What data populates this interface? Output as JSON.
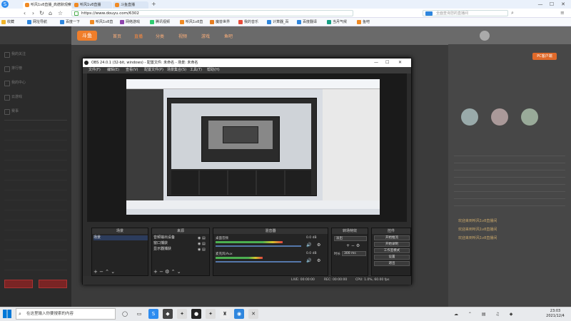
{
  "browser": {
    "tabs": [
      {
        "label": "听风1v8直播_高德默观察"
      },
      {
        "label": "听风1v8直播"
      },
      {
        "label": "斗鱼直播"
      }
    ],
    "address": "https://www.douyu.com/6302",
    "search_placeholder": "全面查询您的直播间",
    "bookmarks": [
      {
        "label": "收藏",
        "color": "#f0b429"
      },
      {
        "label": "网址导航",
        "color": "#2e86de"
      },
      {
        "label": "百度一下",
        "color": "#2e86de"
      },
      {
        "label": "听风1v8直",
        "color": "#f08a24"
      },
      {
        "label": "网络游戏",
        "color": "#8e44ad"
      },
      {
        "label": "腾讯视频",
        "color": "#2ecc71"
      },
      {
        "label": "听风1v8直",
        "color": "#f08a24"
      },
      {
        "label": "魔兽世界",
        "color": "#e67e22"
      },
      {
        "label": "我的音乐",
        "color": "#e74c3c"
      },
      {
        "label": "计算器_百",
        "color": "#2e86de"
      },
      {
        "label": "百度翻译",
        "color": "#2e86de"
      },
      {
        "label": "当月气候",
        "color": "#16a085"
      },
      {
        "label": "鱼吧",
        "color": "#f08a24"
      }
    ]
  },
  "site": {
    "logo": "斗鱼",
    "nav": [
      "首页",
      "直播",
      "分类",
      "视频",
      "游戏",
      "鱼吧"
    ],
    "sidebar": [
      "我的关注",
      "排行榜",
      "我的中心",
      "云游戏",
      "赛事"
    ],
    "right_panel": {
      "badge": "PC客户端",
      "notices": [
        "欢迎来到听风1v8直播间",
        "欢迎来到听风1v8直播间",
        "欢迎来到听风1v8直播间"
      ]
    }
  },
  "obs": {
    "title": "OBS 24.0.1 (32-bit, windows) - 配置文件: 未命名 - 场景: 未命名",
    "menu": [
      "文件(F)",
      "编辑(E)",
      "查看(V)",
      "配置文件(P)",
      "场景集合(S)",
      "工具(T)",
      "帮助(H)"
    ],
    "docks": {
      "scenes": {
        "title": "场景",
        "items": [
          "场景"
        ]
      },
      "sources": {
        "title": "来源",
        "items": [
          "音频输出设备",
          "窗口捕获",
          "显示器捕获"
        ]
      },
      "mixer": {
        "title": "混音器",
        "tracks": [
          {
            "name": "桌面音频",
            "db": "0.0 dB",
            "level": 0.78
          },
          {
            "name": "麦克风/Aux",
            "db": "0.0 dB",
            "level": 0.55
          }
        ]
      },
      "transitions": {
        "title": "转场特效",
        "mode": "淡出",
        "duration_label": "时长",
        "duration": "300 ms"
      },
      "controls": {
        "title": "控件",
        "buttons": [
          "开始推流",
          "开始录制",
          "工作室模式",
          "设置",
          "退出"
        ]
      }
    },
    "status": {
      "live": "LIVE: 00:00:00",
      "rec": "REC: 00:00:00",
      "cpu": "CPU: 1.0%, 60.00 fps"
    }
  },
  "taskbar": {
    "search_placeholder": "在这里输入你要搜索的内容",
    "time": "23:03",
    "date": "2021/12/4"
  }
}
